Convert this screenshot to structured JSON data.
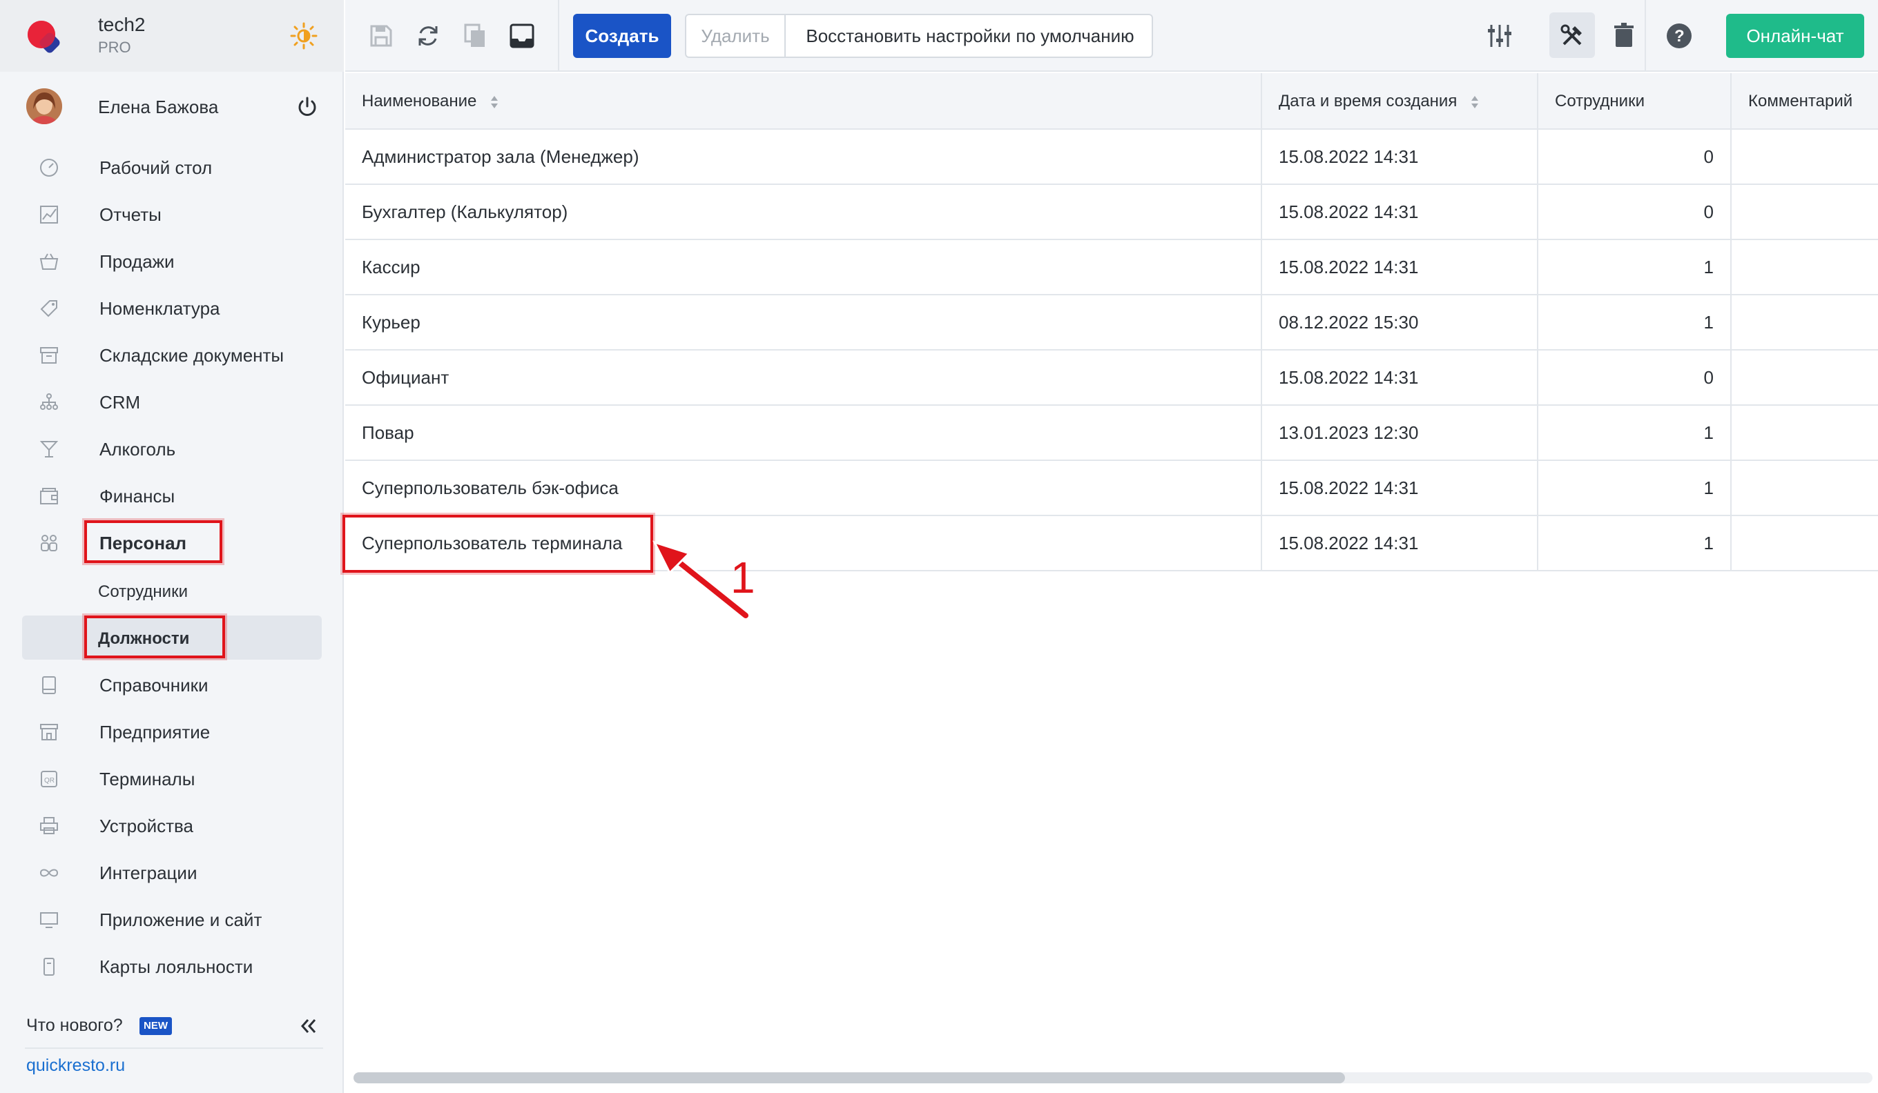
{
  "brand": {
    "name": "tech2",
    "plan": "PRO"
  },
  "user": {
    "name": "Елена Бажова"
  },
  "sidebar": {
    "items": [
      {
        "label": "Рабочий стол",
        "icon": "dashboard-icon"
      },
      {
        "label": "Отчеты",
        "icon": "chart-icon"
      },
      {
        "label": "Продажи",
        "icon": "basket-icon"
      },
      {
        "label": "Номенклатура",
        "icon": "tag-icon"
      },
      {
        "label": "Складские документы",
        "icon": "archive-icon"
      },
      {
        "label": "CRM",
        "icon": "people-tree-icon"
      },
      {
        "label": "Алкоголь",
        "icon": "cocktail-icon"
      },
      {
        "label": "Финансы",
        "icon": "wallet-icon"
      },
      {
        "label": "Персонал",
        "icon": "staff-icon"
      }
    ],
    "personnel_sub": [
      {
        "label": "Сотрудники"
      },
      {
        "label": "Должности"
      }
    ],
    "items_after": [
      {
        "label": "Справочники",
        "icon": "book-icon"
      },
      {
        "label": "Предприятие",
        "icon": "store-icon"
      },
      {
        "label": "Терминалы",
        "icon": "qr-icon"
      },
      {
        "label": "Устройства",
        "icon": "printer-icon"
      },
      {
        "label": "Интеграции",
        "icon": "infinity-icon"
      },
      {
        "label": "Приложение и сайт",
        "icon": "monitor-icon"
      },
      {
        "label": "Карты лояльности",
        "icon": "card-icon"
      }
    ],
    "whats_new": "Что нового?",
    "new_badge": "NEW",
    "site_link": "quickresto.ru"
  },
  "toolbar": {
    "create_label": "Создать",
    "delete_label": "Удалить",
    "restore_label": "Восстановить настройки по умолчанию",
    "chat_label": "Онлайн-чат"
  },
  "table": {
    "columns": [
      "Наименование",
      "Дата и время создания",
      "Сотрудники",
      "Комментарий"
    ],
    "rows": [
      {
        "name": "Администратор зала (Менеджер)",
        "created": "15.08.2022 14:31",
        "employees": "0",
        "comment": ""
      },
      {
        "name": "Бухгалтер (Калькулятор)",
        "created": "15.08.2022 14:31",
        "employees": "0",
        "comment": ""
      },
      {
        "name": "Кассир",
        "created": "15.08.2022 14:31",
        "employees": "1",
        "comment": ""
      },
      {
        "name": "Курьер",
        "created": "08.12.2022 15:30",
        "employees": "1",
        "comment": ""
      },
      {
        "name": "Официант",
        "created": "15.08.2022 14:31",
        "employees": "0",
        "comment": ""
      },
      {
        "name": "Повар",
        "created": "13.01.2023 12:30",
        "employees": "1",
        "comment": ""
      },
      {
        "name": "Суперпользователь бэк-офиса",
        "created": "15.08.2022 14:31",
        "employees": "1",
        "comment": ""
      },
      {
        "name": "Суперпользователь терминала",
        "created": "15.08.2022 14:31",
        "employees": "1",
        "comment": ""
      }
    ]
  },
  "annotation": {
    "step": "1"
  },
  "colors": {
    "primary": "#1a54c6",
    "chat": "#1fbb8a",
    "highlight": "#e0141b",
    "sidebar_bg": "#f3f5f8"
  }
}
